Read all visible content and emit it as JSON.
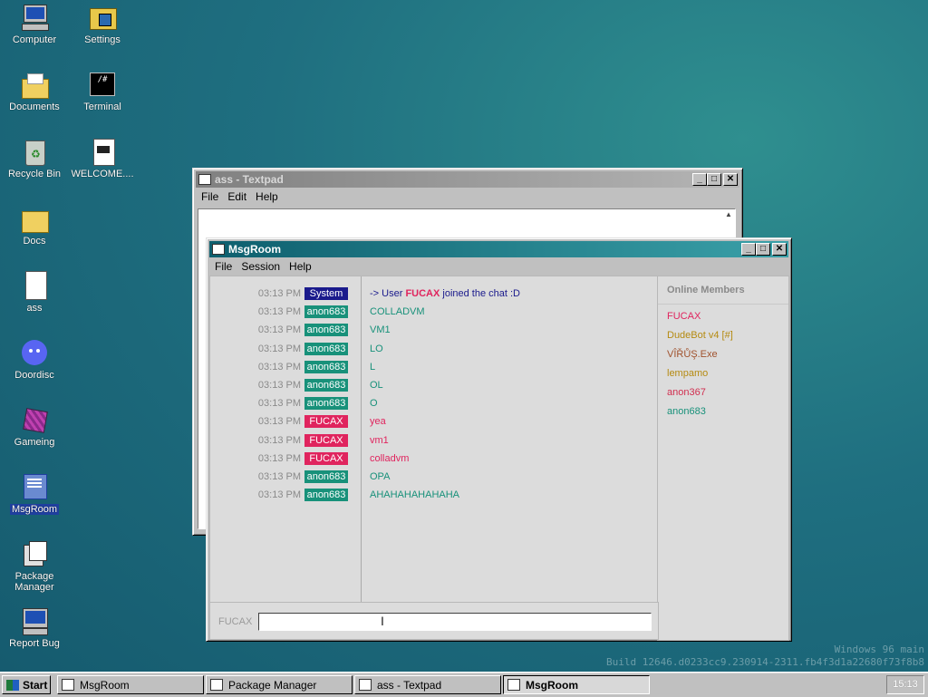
{
  "desktop": {
    "icons": [
      {
        "label": "Computer"
      },
      {
        "label": "Settings"
      },
      {
        "label": "Documents"
      },
      {
        "label": "Terminal"
      },
      {
        "label": "Recycle Bin"
      },
      {
        "label": "WELCOME...."
      },
      {
        "label": "Docs"
      },
      {
        "label": "ass"
      },
      {
        "label": "Doordisc"
      },
      {
        "label": "Gameing"
      },
      {
        "label": "MsgRoom"
      },
      {
        "label": "Package Manager"
      },
      {
        "label": "Report Bug"
      }
    ],
    "watermark_line1": "Windows 96 main",
    "watermark_line2": "Build 12646.d0233cc9.230914-2311.fb4f3d1a22680f73f8b8"
  },
  "textpad": {
    "title": "ass - Textpad",
    "menu": [
      "File",
      "Edit",
      "Help"
    ]
  },
  "msgroom": {
    "title": "MsgRoom",
    "menu": [
      "File",
      "Session",
      "Help"
    ],
    "messages": [
      {
        "time": "03:13 PM",
        "user": "System",
        "text_prefix": "-> User ",
        "text_bold": "FUCAX",
        "text_suffix": " joined the chat :D"
      },
      {
        "time": "03:13 PM",
        "user": "anon683",
        "text": "COLLADVM"
      },
      {
        "time": "03:13 PM",
        "user": "anon683",
        "text": "VM1"
      },
      {
        "time": "03:13 PM",
        "user": "anon683",
        "text": "LO"
      },
      {
        "time": "03:13 PM",
        "user": "anon683",
        "text": "L"
      },
      {
        "time": "03:13 PM",
        "user": "anon683",
        "text": "OL"
      },
      {
        "time": "03:13 PM",
        "user": "anon683",
        "text": "O"
      },
      {
        "time": "03:13 PM",
        "user": "FUCAX",
        "text": "yea"
      },
      {
        "time": "03:13 PM",
        "user": "FUCAX",
        "text": "vm1"
      },
      {
        "time": "03:13 PM",
        "user": "FUCAX",
        "text": "colladvm"
      },
      {
        "time": "03:13 PM",
        "user": "anon683",
        "text": "OPA"
      },
      {
        "time": "03:13 PM",
        "user": "anon683",
        "text": "AHAHAHAHAHAHA"
      }
    ],
    "members_header": "Online Members",
    "members": [
      {
        "name": "FUCAX"
      },
      {
        "name": "DudeBot v4 [#]"
      },
      {
        "name": "VÎŘŮŞ.Exe"
      },
      {
        "name": "lempamo"
      },
      {
        "name": "anon367"
      },
      {
        "name": "anon683"
      }
    ],
    "input_label": "FUCAX",
    "input_value": ""
  },
  "colors": {
    "System": "#1a1a8c",
    "anon683": "#18917a",
    "FUCAX": "#e0245e",
    "DudeBot v4 [#]": "#b58a10",
    "VÎŘŮŞ.Exe": "#a0522d",
    "lempamo": "#b58a10",
    "anon367": "#d12e4f"
  },
  "taskbar": {
    "start": "Start",
    "items": [
      {
        "label": "MsgRoom"
      },
      {
        "label": "Package Manager"
      },
      {
        "label": "ass - Textpad"
      },
      {
        "label": "MsgRoom"
      }
    ],
    "clock": "15:13"
  }
}
